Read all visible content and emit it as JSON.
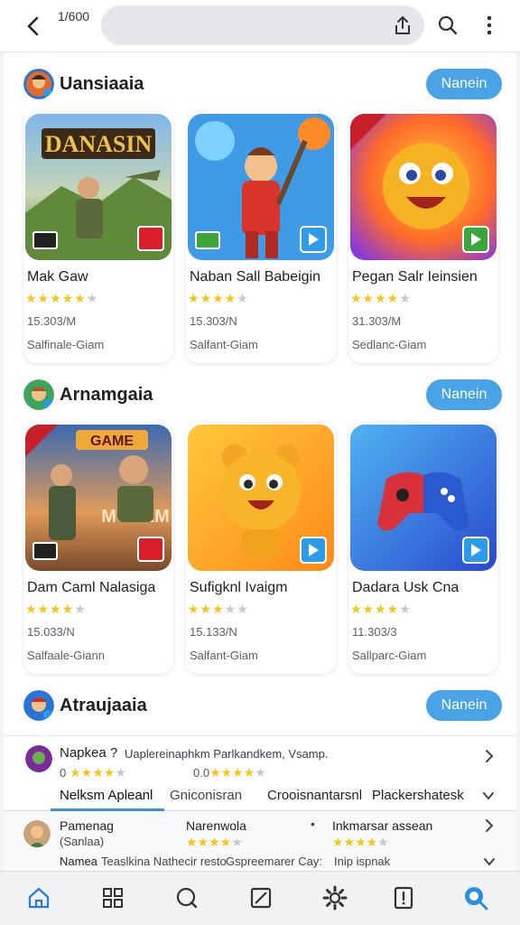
{
  "topbar": {
    "page_counter": "1/600"
  },
  "sections": [
    {
      "title": "Uansiaaia",
      "more_label": "Nanein",
      "apps": [
        {
          "name": "Mak Gaw",
          "stars": "★★★★★",
          "stars_off": "",
          "count": "15.303/M",
          "sub": "Salfinale-Giam"
        },
        {
          "name": "Naban Sall Babeigin",
          "stars": "★★★★",
          "stars_off": "★",
          "count": "15.303/N",
          "sub": "Salfant-Giam"
        },
        {
          "name": "Pegan Salr Ieinsien",
          "stars": "★★★★",
          "stars_off": "★",
          "count": "31.303/M",
          "sub": "Sedlanc-Giam"
        }
      ]
    },
    {
      "title": "Arnamgaia",
      "more_label": "Nanein",
      "apps": [
        {
          "name": "Dam Caml Nalasiga",
          "stars": "★★★★",
          "stars_off": "★",
          "count": "15.033/N",
          "sub": "Salfaale-Giann"
        },
        {
          "name": "Sufigknl Ivaigm",
          "stars": "★★★",
          "stars_off": "★★",
          "count": "15.133/N",
          "sub": "Salfant-Giam"
        },
        {
          "name": "Dadara Usk Cna",
          "stars": "★★★★",
          "stars_off": "★",
          "count": "11.303/3",
          "sub": "Sallparc-Giam"
        }
      ]
    },
    {
      "title": "Atraujaaia",
      "more_label": "Nanein"
    }
  ],
  "list_row": {
    "title": "Napkea ?",
    "desc": "Uaplereinaphkm Parlkandkem, Vsamp.",
    "stars_a_prefix": "0",
    "stars_a": "★★★★",
    "stars_a_off": "★",
    "stars_b_prefix": "0.0",
    "stars_b": "★★★★",
    "stars_b_off": "★"
  },
  "tabs": [
    "Nelksm Apleanl",
    "Gniconisran",
    "Crooisnantarsnl",
    "Plackershatesk"
  ],
  "row2": {
    "c1_title": "Pamenag",
    "c1_sub": "(Sanlaa)",
    "c2_title": "Narenwola",
    "c2_stars": "★★★★",
    "c2_stars_off": "★",
    "c3_title": "Inkmarsar assean",
    "c3_stars": "★★★★",
    "c3_stars_off": "★",
    "f1": "Namea",
    "f2": "Teaslkina Nathecir resto",
    "f3": "Gspreemarer Cay:",
    "f4": "Inip ispnak"
  },
  "colors": {
    "accent": "#4aa3e6",
    "star": "#f5c518"
  }
}
